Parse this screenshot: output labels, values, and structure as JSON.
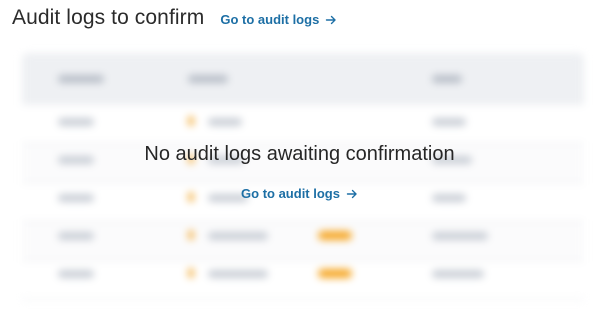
{
  "header": {
    "title": "Audit logs to confirm",
    "link_label": "Go to audit logs"
  },
  "empty_state": {
    "message": "No audit logs awaiting confirmation",
    "link_label": "Go to audit logs"
  },
  "colors": {
    "link": "#1d6fa5",
    "text": "#262626",
    "accent_orange": "#f6a623"
  },
  "icons": {
    "link_arrow": "arrow-right-icon"
  }
}
